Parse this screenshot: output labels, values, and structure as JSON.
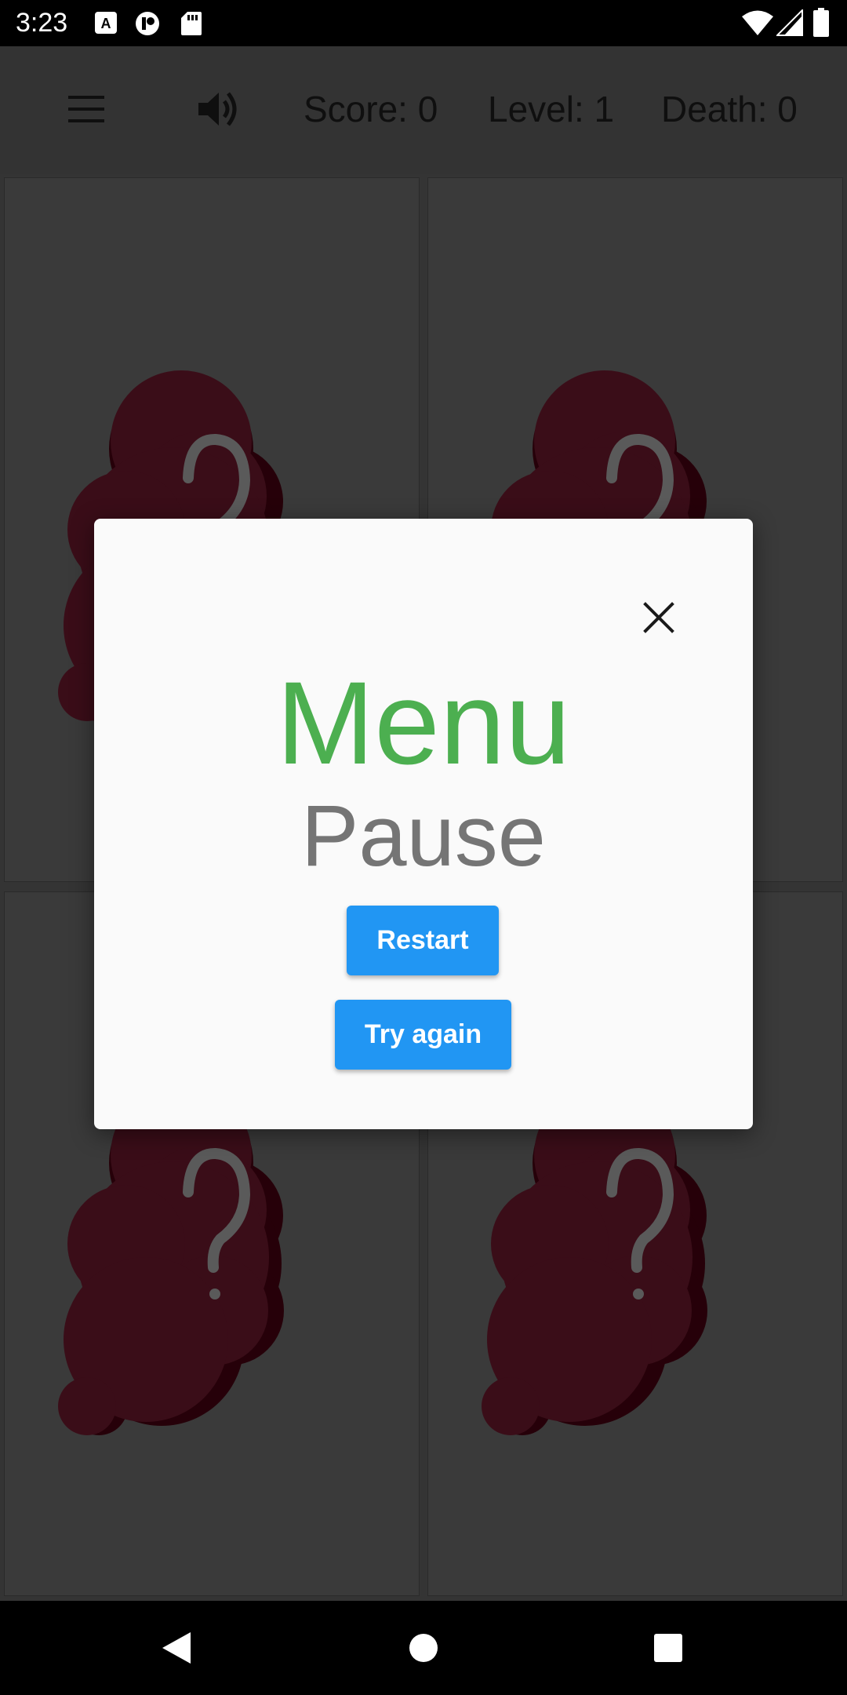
{
  "status_bar": {
    "time": "3:23",
    "icons": [
      "a-box-icon",
      "tag-icon",
      "sd-card-icon",
      "wifi-icon",
      "signal-icon",
      "battery-icon"
    ]
  },
  "hud": {
    "menu_icon": "hamburger-menu-icon",
    "sound_icon": "speaker-icon",
    "score": "Score: 0",
    "level": "Level: 1",
    "death": "Death: 0"
  },
  "grid": {
    "cards": [
      {
        "name": "card-1",
        "content": "question-mark-splat-icon"
      },
      {
        "name": "card-2",
        "content": "question-mark-splat-icon"
      },
      {
        "name": "card-3",
        "content": "question-mark-splat-icon"
      },
      {
        "name": "card-4",
        "content": "question-mark-splat-icon"
      }
    ],
    "splat_color": "#3a0d18",
    "splat_shadow_color": "#260009"
  },
  "dialog": {
    "title": "Menu",
    "subtitle": "Pause",
    "buttons": {
      "restart": "Restart",
      "try_again": "Try again"
    },
    "close_icon": "close-icon"
  },
  "colors": {
    "accent_green": "#4caf50",
    "button_blue": "#2196f3",
    "subtitle_gray": "#757575"
  },
  "nav_bar": {
    "back_icon": "back-triangle-icon",
    "home_icon": "home-circle-icon",
    "recents_icon": "recents-square-icon"
  }
}
